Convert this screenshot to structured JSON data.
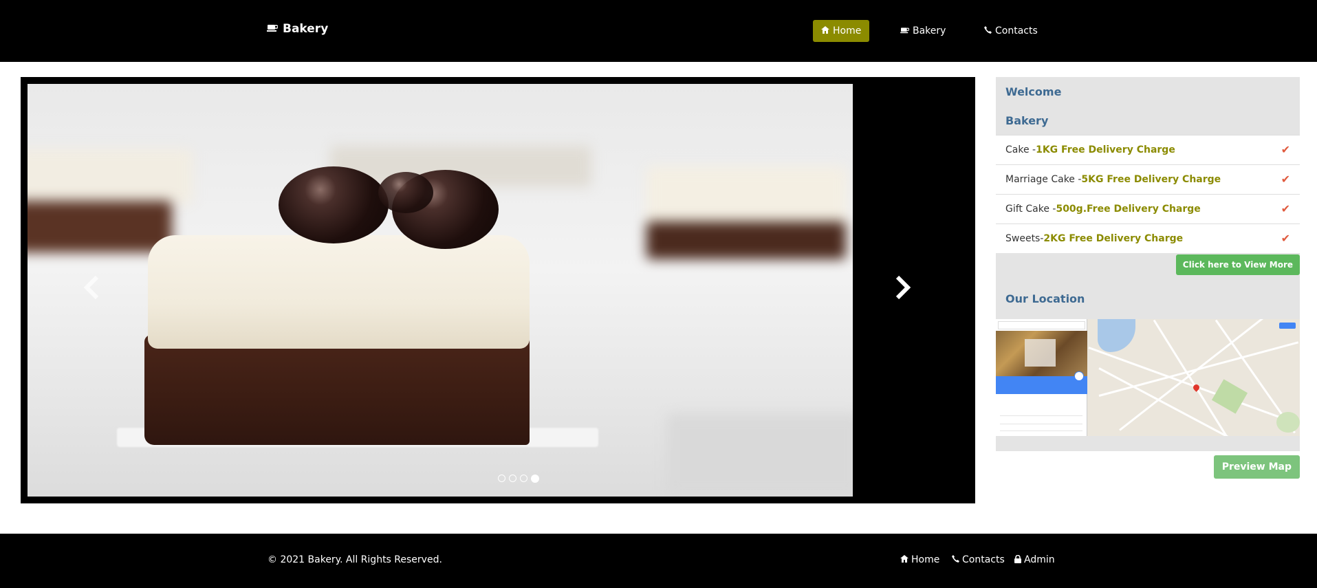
{
  "navbar": {
    "brand_icon": "coffee-cup-icon",
    "brand": "Bakery",
    "links": [
      {
        "label": "Home",
        "icon": "home-icon",
        "active": true
      },
      {
        "label": "Bakery",
        "icon": "coffee-cup-icon",
        "active": false
      },
      {
        "label": "Contacts",
        "icon": "phone-icon",
        "active": false
      }
    ],
    "active_color": "#8b8b00"
  },
  "carousel": {
    "slide_count": 4,
    "active_index": 3,
    "prev_icon": "chevron-left-icon",
    "next_icon": "chevron-right-icon"
  },
  "sidebar": {
    "welcome": "Welcome",
    "section_title": "Bakery",
    "items": [
      {
        "name": "Cake - ",
        "highlight": "1KG Free Delivery Charge"
      },
      {
        "name": "Marriage Cake - ",
        "highlight": "5KG Free Delivery Charge"
      },
      {
        "name": "Gift Cake - ",
        "highlight": "500g.Free Delivery Charge"
      },
      {
        "name": "Sweets- ",
        "highlight": "2KG Free Delivery Charge"
      }
    ],
    "check_icon": "checkmark-icon",
    "view_more": "Click here to View More",
    "location_title": "Our Location",
    "preview_map": "Preview Map",
    "highlight_color": "#8b8b00",
    "title_color": "#3e6a92"
  },
  "footer": {
    "copyright": "© 2021 Bakery. All Rights Reserved.",
    "links": [
      {
        "label": "Home",
        "icon": "home-icon"
      },
      {
        "label": "Contacts",
        "icon": "phone-icon"
      },
      {
        "label": "Admin",
        "icon": "lock-icon"
      }
    ]
  }
}
